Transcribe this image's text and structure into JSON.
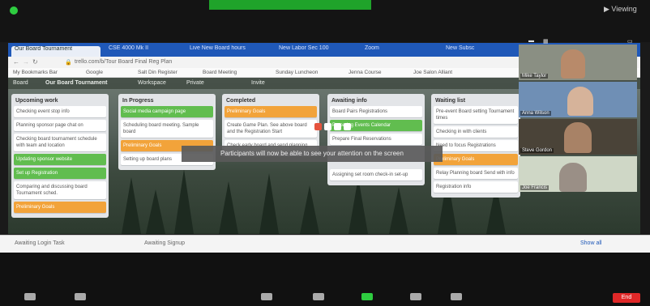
{
  "zoom": {
    "top_right": "▶ Viewing",
    "banner_right": "",
    "toolbar_end": "End"
  },
  "browser": {
    "tabs": [
      "Our Board Tournament",
      "CSE 4000 Mk II",
      "Live New Board hours",
      "New Labor Sec 100",
      "Zoom",
      "New Subsc"
    ],
    "address": "trello.com/b/Tour Board  Final Reg Plan",
    "bookmarks": [
      "My Bookmarks Bar",
      "Google",
      "Salt Din Register",
      "Board Meeting",
      "Sunday Luncheon",
      "Jenna Course",
      "Joe Salon Alliant"
    ]
  },
  "board": {
    "header": [
      "Board",
      "Our Board Tournament",
      "Workspace",
      "Private",
      "Invite"
    ],
    "lists": [
      {
        "title": "Upcoming work",
        "cards": [
          {
            "text": "Checking event stop info",
            "color": "white"
          },
          {
            "text": "Planning sponsor page chat on",
            "color": "white"
          },
          {
            "text": "Checking board tournament schedule with team and location",
            "color": "white"
          },
          {
            "text": "Updating sponsor website",
            "color": "green"
          },
          {
            "text": "Set up Registration",
            "color": "green"
          },
          {
            "text": "Comparing and discussing board Tournament sched.",
            "color": "white"
          },
          {
            "text": "Preliminary Goals",
            "color": "orange"
          }
        ]
      },
      {
        "title": "In Progress",
        "cards": [
          {
            "text": "Social media campaign page",
            "color": "green"
          },
          {
            "text": "Scheduling board meeting. Sample board ",
            "color": "white"
          },
          {
            "text": "Preliminary Goals",
            "color": "orange"
          },
          {
            "text": "Setting up board plans",
            "color": "white"
          }
        ]
      },
      {
        "title": "Completed",
        "cards": [
          {
            "text": "Preliminary Goals",
            "color": "orange"
          },
          {
            "text": "Create Game Plan. See above board and the Registration Start",
            "color": "white"
          },
          {
            "text": "Check early board and send planning",
            "color": "white"
          }
        ]
      },
      {
        "title": "Awaiting info",
        "cards": [
          {
            "text": "Board Pairs Registrations",
            "color": "white"
          },
          {
            "text": "Preparing Events Calendar",
            "color": "green"
          },
          {
            "text": "Prepare Final Reservations",
            "color": "white"
          },
          {
            "text": "Assigning set room check-in set-up",
            "color": "white"
          }
        ]
      },
      {
        "title": "Waiting list",
        "cards": [
          {
            "text": "Pre-event Board setting Tournament times",
            "color": "white"
          },
          {
            "text": "Checking in with clients",
            "color": "white"
          },
          {
            "text": "Need to focus Registrations",
            "color": "white"
          },
          {
            "text": "Preliminary Goals",
            "color": "orange"
          },
          {
            "text": "Relay Planning board Send with info",
            "color": "white"
          },
          {
            "text": "Registration info",
            "color": "white"
          }
        ]
      }
    ],
    "toast": "Participants will now be able to see your attention on the screen"
  },
  "participants": [
    {
      "name": "Mike Taylor",
      "bg": "#8a8f83"
    },
    {
      "name": "Anna Wilson",
      "bg": "#6f8fb5"
    },
    {
      "name": "Steve Gordon",
      "bg": "#4a4338"
    },
    {
      "name": "Joe Francis",
      "bg": "#cfd7c6"
    }
  ],
  "statusbar": {
    "left": "Awaiting Login Task",
    "middle": "Awaiting Signup",
    "right": "Show all"
  }
}
